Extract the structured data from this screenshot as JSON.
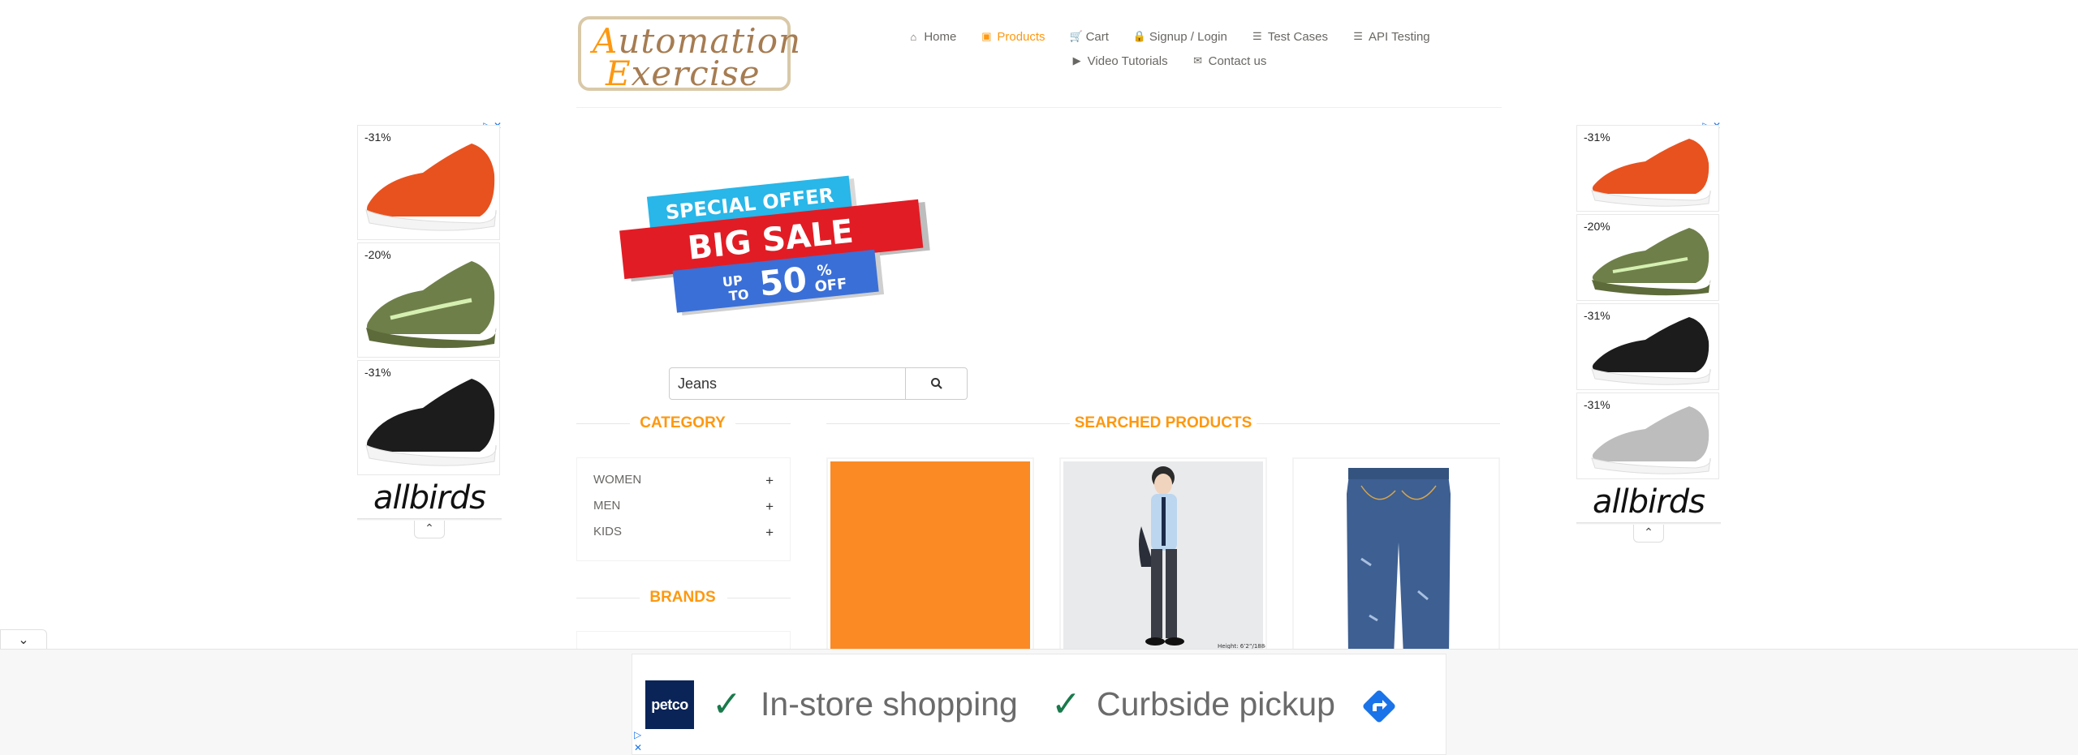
{
  "logo": {
    "line1_cap": "A",
    "line1_rest": "utomation",
    "line2_cap": "E",
    "line2_rest": "xercise"
  },
  "nav": {
    "items": [
      {
        "label": "Home",
        "icon": "home-icon"
      },
      {
        "label": "Products",
        "icon": "products-icon",
        "active": true
      },
      {
        "label": "Cart",
        "icon": "cart-icon"
      },
      {
        "label": "Signup / Login",
        "icon": "lock-icon"
      },
      {
        "label": "Test Cases",
        "icon": "list-icon"
      },
      {
        "label": "API Testing",
        "icon": "list-icon"
      },
      {
        "label": "Video Tutorials",
        "icon": "youtube-icon"
      },
      {
        "label": "Contact us",
        "icon": "envelope-icon"
      }
    ]
  },
  "banner": {
    "line1": "SPECIAL OFFER",
    "line2": "BIG SALE",
    "line3a": "UP",
    "line3b": "TO",
    "line3c": "50",
    "line3d": "%",
    "line3e": "OFF"
  },
  "side_ads": {
    "left": {
      "discounts": [
        "-31%",
        "-20%",
        "-31%"
      ],
      "brand": "allbirds"
    },
    "right": {
      "discounts": [
        "-31%",
        "-20%",
        "-31%",
        "-31%"
      ],
      "brand": "allbirds"
    }
  },
  "search": {
    "value": "Jeans"
  },
  "sidebar": {
    "category_title": "CATEGORY",
    "categories": [
      "WOMEN",
      "MEN",
      "KIDS"
    ],
    "brands_title": "BRANDS"
  },
  "main": {
    "title": "SEARCHED PRODUCTS",
    "product2_caption": "Height: 6’2”/188cm"
  },
  "bottom_ad": {
    "brand": "petco",
    "item1": "In-store shopping",
    "item2": "Curbside pickup"
  },
  "colors": {
    "accent": "#fe980f",
    "text": "#696763",
    "petco": "#0a2458",
    "check": "#1a7a4c"
  }
}
